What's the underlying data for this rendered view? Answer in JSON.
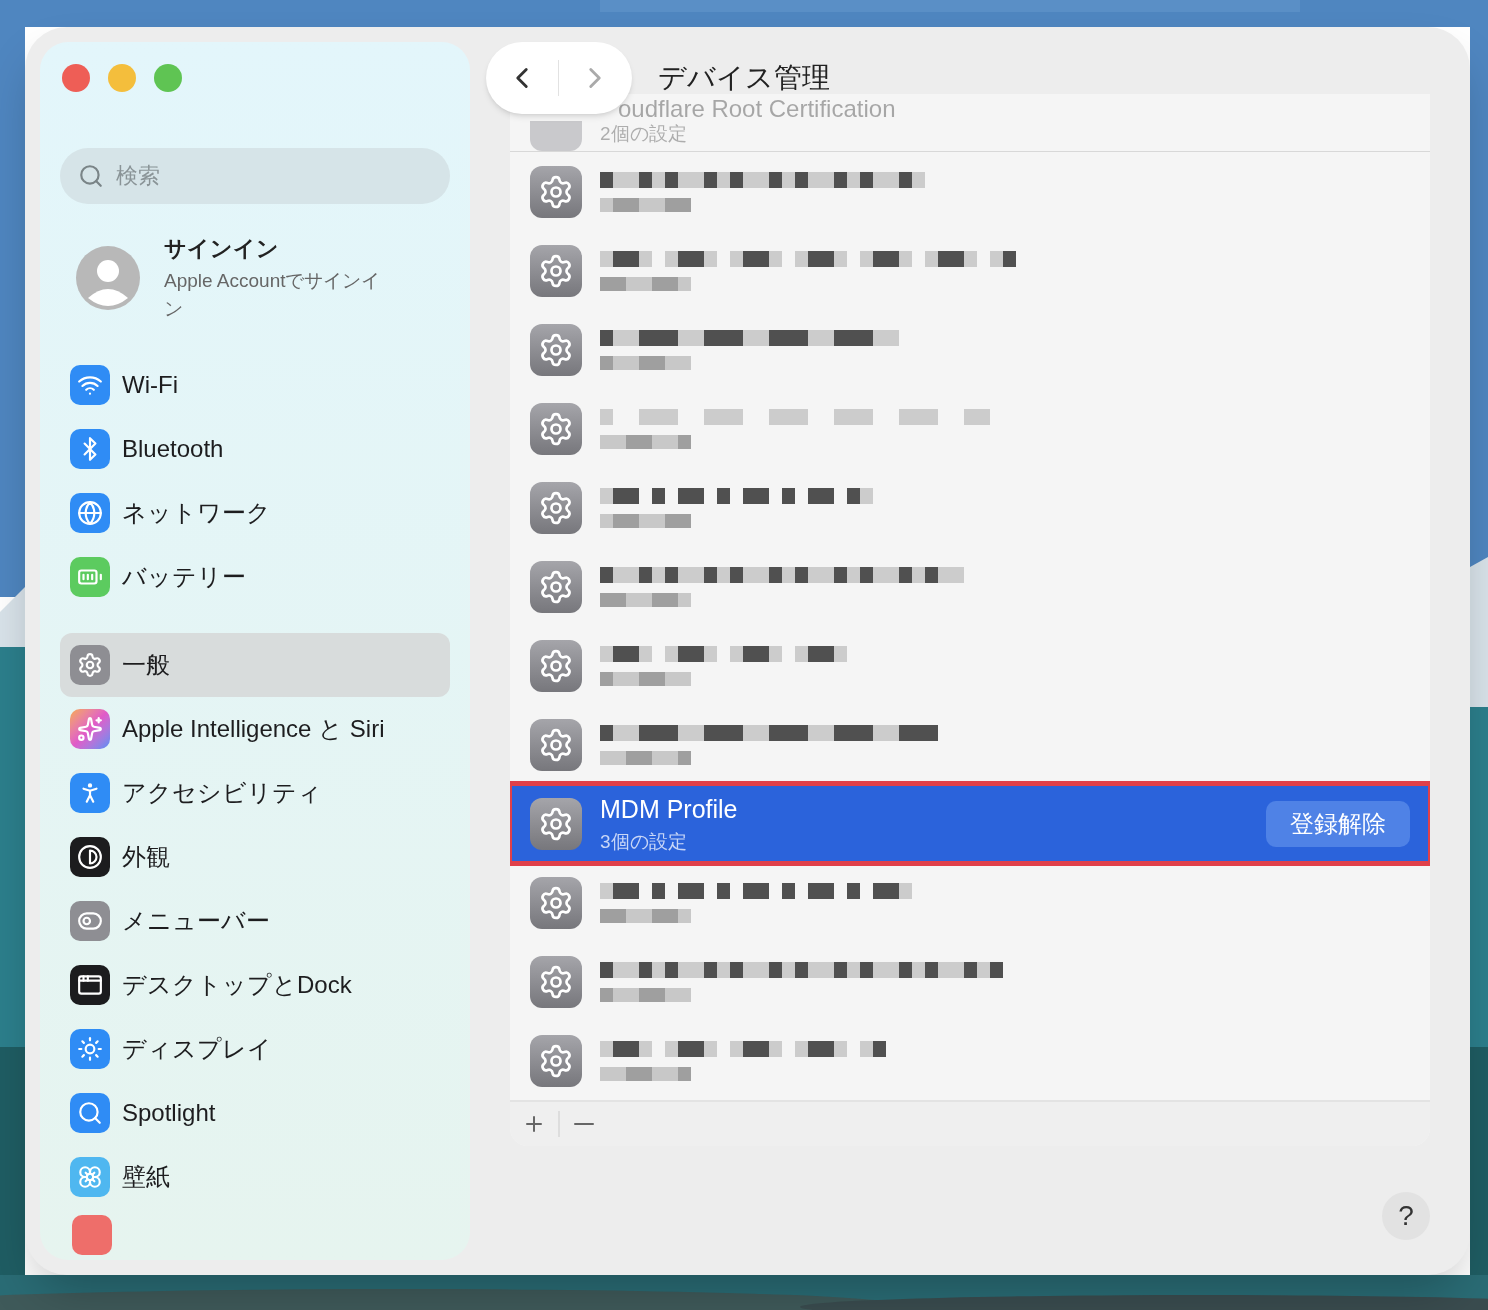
{
  "window": {
    "title": "デバイス管理"
  },
  "sidebar": {
    "search": {
      "placeholder": "検索"
    },
    "account": {
      "title": "サインイン",
      "subtitle": "Apple Accountでサインイン"
    },
    "groups": [
      [
        {
          "label": "Wi-Fi",
          "selected": false
        },
        {
          "label": "Bluetooth",
          "selected": false
        },
        {
          "label": "ネットワーク",
          "selected": false
        },
        {
          "label": "バッテリー",
          "selected": false
        }
      ],
      [
        {
          "label": "一般",
          "selected": true
        },
        {
          "label": "Apple Intelligence と Siri",
          "selected": false
        },
        {
          "label": "アクセシビリティ",
          "selected": false
        },
        {
          "label": "外観",
          "selected": false
        },
        {
          "label": "メニューバー",
          "selected": false
        },
        {
          "label": "デスクトップとDock",
          "selected": false
        },
        {
          "label": "ディスプレイ",
          "selected": false
        },
        {
          "label": "Spotlight",
          "selected": false
        },
        {
          "label": "壁紙",
          "selected": false
        }
      ]
    ]
  },
  "profiles": [
    {
      "kind": "faded",
      "name": "oudflare Root Certification",
      "detail": "2個の設定",
      "selected": false
    },
    {
      "kind": "redacted",
      "selected": false
    },
    {
      "kind": "redacted",
      "selected": false
    },
    {
      "kind": "redacted",
      "selected": false
    },
    {
      "kind": "redacted",
      "selected": false
    },
    {
      "kind": "redacted",
      "selected": false
    },
    {
      "kind": "redacted",
      "selected": false
    },
    {
      "kind": "redacted",
      "selected": false
    },
    {
      "kind": "redacted",
      "selected": false
    },
    {
      "kind": "profile",
      "name": "MDM Profile",
      "detail": "3個の設定",
      "selected": true,
      "action": "登録解除"
    },
    {
      "kind": "redacted",
      "selected": false
    },
    {
      "kind": "redacted",
      "selected": false
    },
    {
      "kind": "redacted",
      "selected": false
    }
  ],
  "help": "?"
}
